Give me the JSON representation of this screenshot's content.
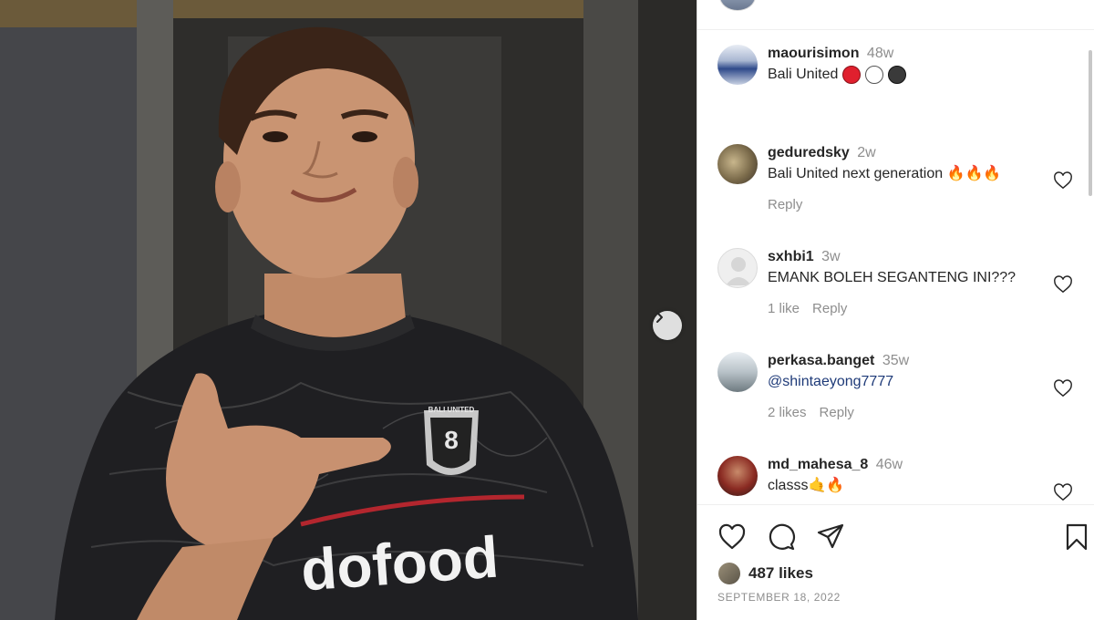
{
  "post": {
    "author": "maourisimon",
    "time": "48w",
    "caption": "Bali United",
    "caption_dots": [
      "#e0202e",
      "#ffffff",
      "#3a3a3a"
    ],
    "likes": "487 likes",
    "date": "SEPTEMBER 18, 2022"
  },
  "photo": {
    "jersey_text": "dofood",
    "crest_text": "BALI UNITED"
  },
  "comments": [
    {
      "user": "geduredsky",
      "time": "2w",
      "text": "Bali United next generation 🔥🔥🔥",
      "likes": "",
      "reply": "Reply"
    },
    {
      "user": "sxhbi1",
      "time": "3w",
      "text": "EMANK BOLEH SEGANTENG INI???",
      "likes": "1 like",
      "reply": "Reply"
    },
    {
      "user": "perkasa.banget",
      "time": "35w",
      "text": "@shintaeyong7777",
      "likes": "2 likes",
      "reply": "Reply"
    },
    {
      "user": "md_mahesa_8",
      "time": "46w",
      "text": "classs🤙🔥",
      "likes": "",
      "reply": ""
    }
  ],
  "icons": {
    "next": "chevron-right-icon",
    "like": "heart-icon",
    "comment": "comment-icon",
    "share": "send-icon",
    "save": "bookmark-icon"
  }
}
